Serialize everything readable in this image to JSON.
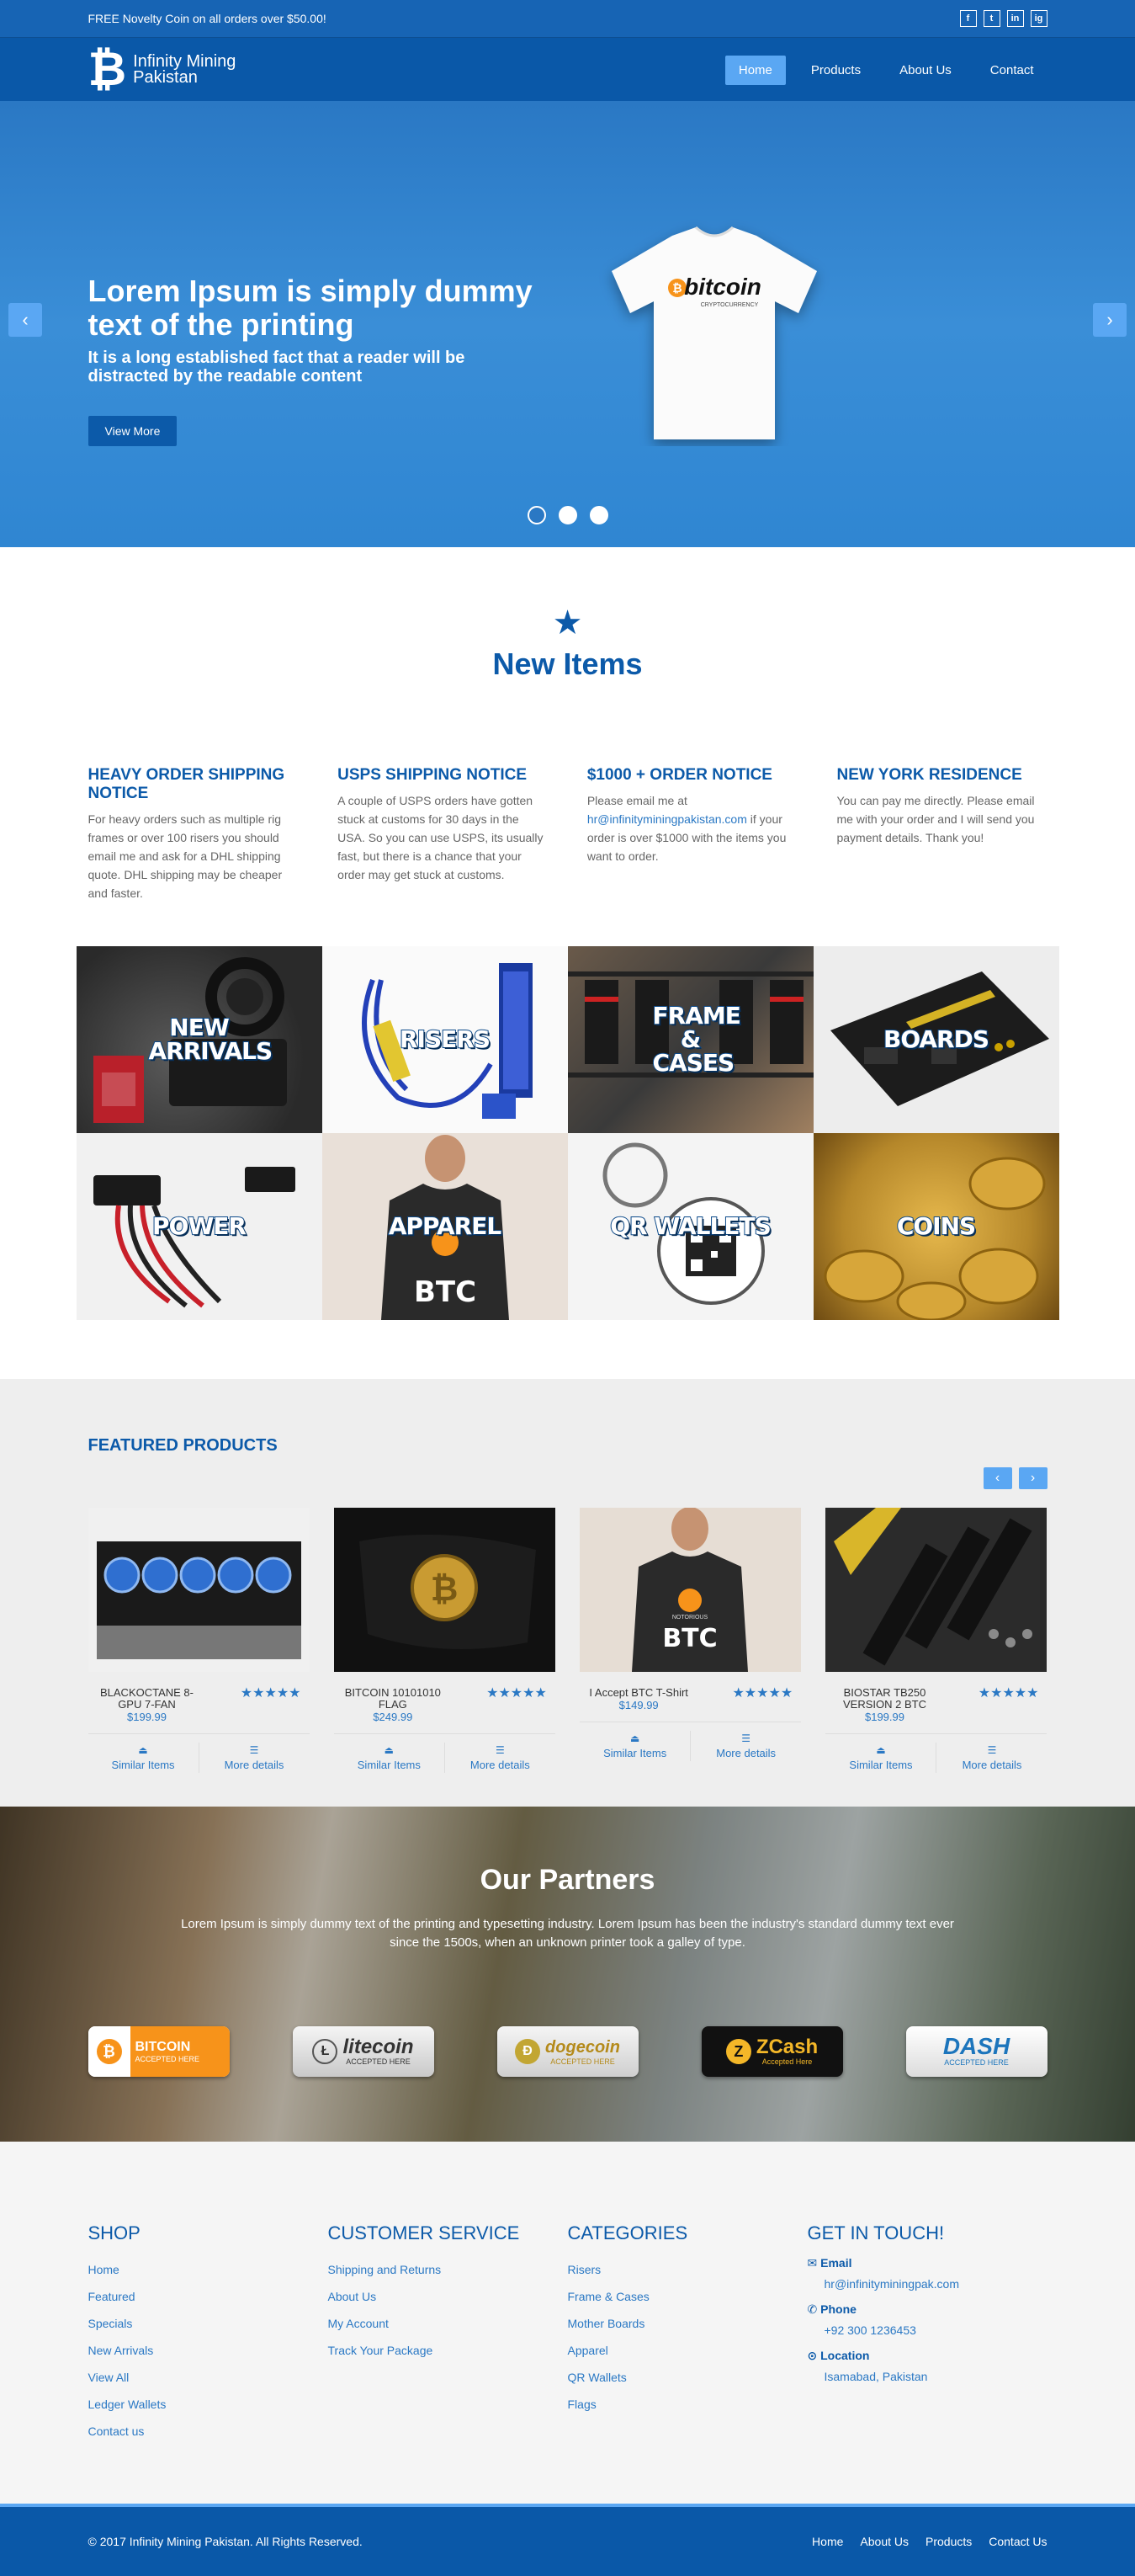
{
  "topbar": {
    "promo": "FREE Novelty Coin on all orders over $50.00!",
    "socials": [
      "f",
      "t",
      "in",
      "ig"
    ]
  },
  "header": {
    "logo_line1": "Infinity Mining",
    "logo_line2": "Pakistan",
    "nav": [
      "Home",
      "Products",
      "About Us",
      "Contact"
    ]
  },
  "hero": {
    "title": "Lorem Ipsum is simply dummy text of the printing",
    "subtitle": "It is a long established fact that a reader will be distracted by the readable content",
    "button": "View More",
    "shirt_text": "bitcoin",
    "shirt_sub": "CRYPTOCURRENCY",
    "active_slide": 1,
    "slide_count": 3
  },
  "new_items": {
    "title": "New Items",
    "notices": [
      {
        "title": "Heavy Order Shipping Notice",
        "body": "For heavy orders such as multiple rig frames or over 100 risers you should email me and ask for a DHL shipping quote. DHL shipping may be cheaper and faster."
      },
      {
        "title": "USPS Shipping Notice",
        "body": "A couple of USPS orders have gotten stuck at customs for 30 days in the USA. So you can use USPS, its usually fast, but there is a chance that your order may get stuck at customs."
      },
      {
        "title": "$1000 + Order Notice",
        "body_before": "Please email me at",
        "email": "hr@infinityminingpakistan.com",
        "body_after": "if your order is over $1000 with the items you want to order."
      },
      {
        "title": "New York Residence",
        "body": "You can pay me directly. Please email me with your order and I will send you payment details. Thank you!"
      }
    ],
    "tiles": [
      "New Arrivals",
      "Risers",
      "Frame & Cases",
      "Boards",
      "Power",
      "Apparel",
      "QR Wallets",
      "Coins"
    ]
  },
  "featured": {
    "title": "FEATURED PRODUCTS",
    "products": [
      {
        "name": "BLACKOCTANE 8-GPU 7-FAN",
        "price": "$199.99",
        "rating": 5
      },
      {
        "name": "BITCOIN 10101010 FLAG",
        "price": "$249.99",
        "rating": 5
      },
      {
        "name": "I Accept BTC T-Shirt",
        "price": "$149.99",
        "rating": 5
      },
      {
        "name": "BIOSTAR TB250 VERSION 2 BTC",
        "price": "$199.99",
        "rating": 5
      }
    ],
    "action_similar": "Similar Items",
    "action_details": "More details",
    "apparel_text": "BTC",
    "apparel_small": "NOTORIOUS"
  },
  "partners": {
    "title": "Our Partners",
    "text": "Lorem Ipsum is simply dummy text of the printing and typesetting industry. Lorem Ipsum has been the industry's standard dummy text ever since the 1500s, when an unknown printer took a galley of type.",
    "badges": [
      {
        "name": "BITCOIN",
        "sub": "ACCEPTED HERE"
      },
      {
        "name": "litecoin",
        "sub": "ACCEPTED HERE"
      },
      {
        "name": "dogecoin",
        "sub": "ACCEPTED HERE"
      },
      {
        "name": "ZCash",
        "sub": "Accepted Here"
      },
      {
        "name": "DASH",
        "sub": "ACCEPTED HERE"
      }
    ]
  },
  "footer": {
    "shop": {
      "title": "SHOP",
      "links": [
        "Home",
        "Featured",
        "Specials",
        "New Arrivals",
        "View All",
        "Ledger Wallets",
        "Contact us"
      ]
    },
    "service": {
      "title": "CUSTOMER SERVICE",
      "links": [
        "Shipping and Returns",
        "About Us",
        "My Account",
        "Track Your Package"
      ]
    },
    "categories": {
      "title": "CATEGORIES",
      "links": [
        "Risers",
        "Frame & Cases",
        "Mother Boards",
        "Apparel",
        "QR Wallets",
        "Flags"
      ]
    },
    "contact": {
      "title": "GET IN TOUCH!",
      "email_label": "Email",
      "email": "hr@infinityminingpak.com",
      "phone_label": "Phone",
      "phone": "+92 300 1236453",
      "location_label": "Location",
      "location": "Isamabad, Pakistan"
    }
  },
  "bottom": {
    "copyright": "© 2017 Infinity Mining Pakistan. All Rights Reserved.",
    "nav": [
      "Home",
      "About Us",
      "Products",
      "Contact Us"
    ]
  },
  "colors": {
    "primary": "#0a58a8",
    "accent": "#5aa7f3",
    "link": "#2a78c4"
  }
}
